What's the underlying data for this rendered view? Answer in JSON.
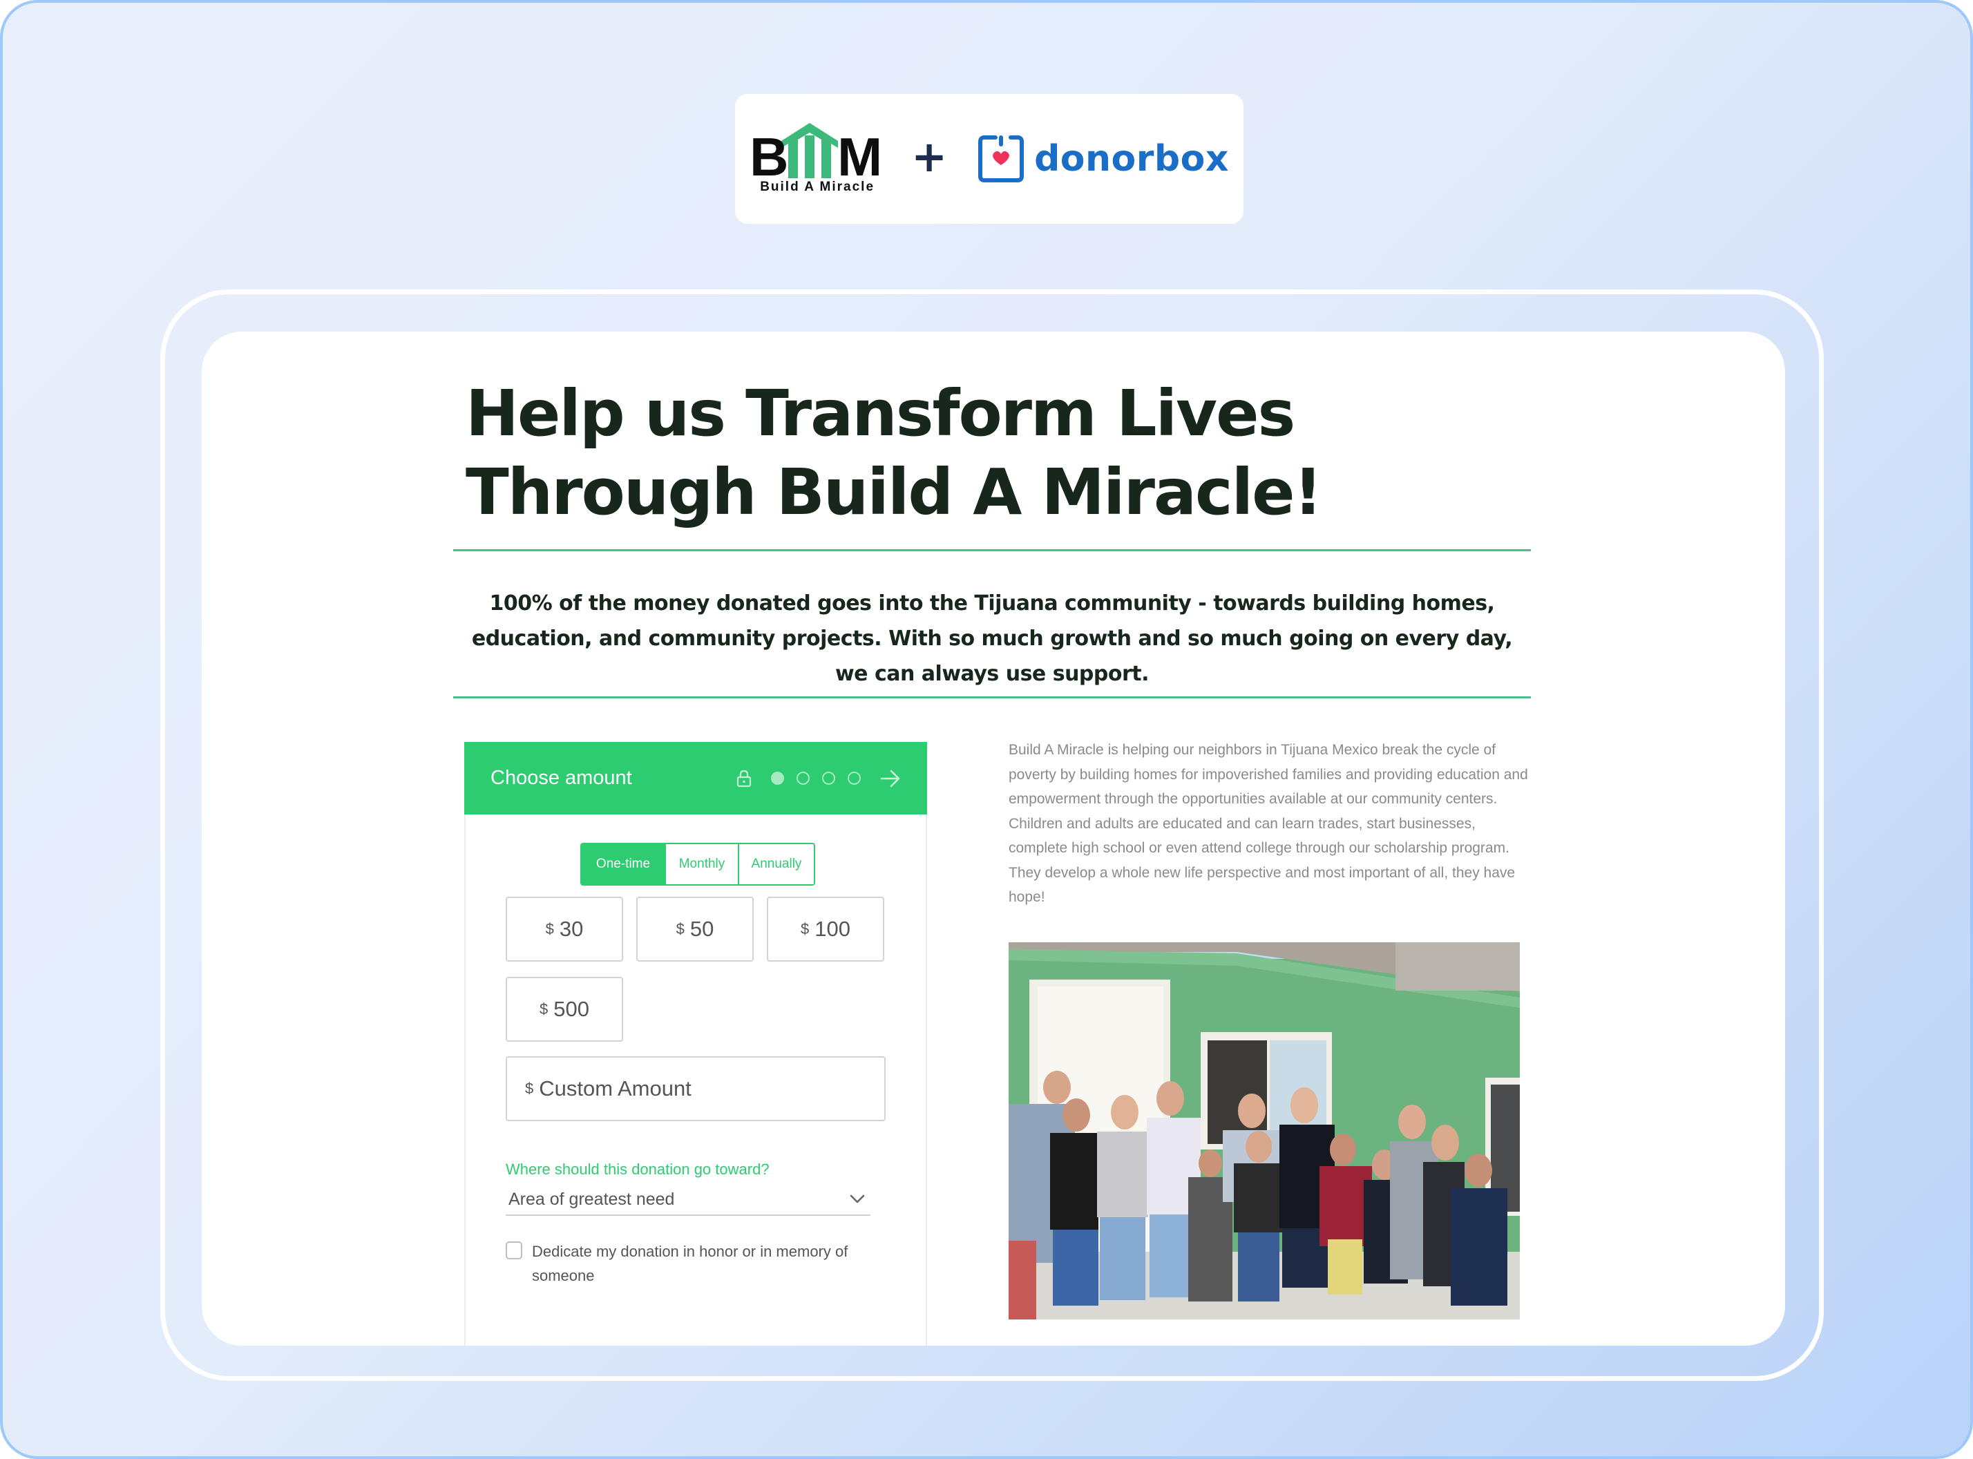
{
  "logos": {
    "bam": {
      "letters": "BAM",
      "caption": "Build A Miracle",
      "brand_green": "#3dba7b"
    },
    "separator": "+",
    "donorbox": {
      "wordmark": "donorbox",
      "brand_blue": "#1a6ec7",
      "heart_color": "#f0325a"
    }
  },
  "page": {
    "headline": "Help us Transform Lives Through Build A Miracle!",
    "intro": "100% of the money donated goes into the Tijuana community - towards building homes, education, and community projects. With so much growth and so much going on every day, we can always use support.",
    "about": "Build A Miracle is helping our neighbors in Tijuana Mexico break the cycle of poverty by building homes for impoverished families and providing education and empowerment through the opportunities available at our community centers.  Children and adults are educated and can learn trades, start businesses, complete high school or even attend college through our scholarship program.   They develop a whole new life perspective and most important of all, they have hope!",
    "photo_alt": "Group photo of volunteers and family in front of a green house"
  },
  "widget": {
    "title": "Choose amount",
    "accent": "#2ecc71",
    "steps_total": 4,
    "step_current": 1,
    "frequencies": [
      {
        "label": "One-time",
        "active": true
      },
      {
        "label": "Monthly",
        "active": false
      },
      {
        "label": "Annually",
        "active": false
      }
    ],
    "currency": "$",
    "amounts": [
      "30",
      "50",
      "100",
      "500"
    ],
    "custom_amount_placeholder": "Custom Amount",
    "custom_amount_value": "",
    "designation_label": "Where should this donation go toward?",
    "designation_selected": "Area of greatest need",
    "dedicate_label": "Dedicate my donation in honor or in memory of someone",
    "dedicate_checked": false
  }
}
